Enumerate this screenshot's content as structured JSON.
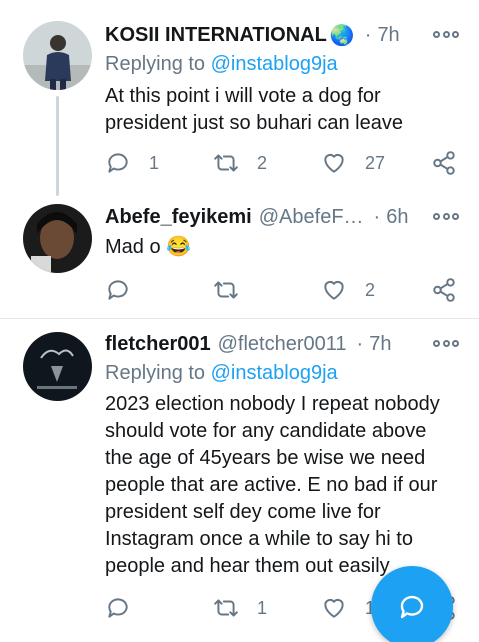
{
  "colors": {
    "accent": "#1da1f2",
    "secondary_text": "#657786",
    "primary_text": "#14171a",
    "divider": "#e1e8ed"
  },
  "tweets": [
    {
      "name": "KOSII INTERNATIONAL",
      "name_emoji": "🌏",
      "handle": "",
      "time": "7h",
      "replying_prefix": "Replying to",
      "replying_to": "@instablog9ja",
      "text_lines": [
        "At this point i will vote a dog for",
        "president just so buhari can leave"
      ],
      "counts": {
        "replies": "1",
        "retweets": "2",
        "likes": "27"
      }
    },
    {
      "name": "Abefe_feyikemi",
      "handle": "@AbefeF…",
      "time": "6h",
      "text": "Mad o",
      "text_emoji": "😂",
      "counts": {
        "replies": "",
        "retweets": "",
        "likes": "2"
      }
    },
    {
      "name": "fletcher001",
      "handle": "@fletcher0011",
      "time": "7h",
      "replying_prefix": "Replying to",
      "replying_to": "@instablog9ja",
      "text_lines": [
        "2023 election nobody I repeat nobody",
        "should vote for any candidate above",
        "the age of 45years be wise we need",
        "people that are active. E no bad if our",
        "president self dey come live for",
        "Instagram once a while to say hi to",
        "people and hear them out easily"
      ],
      "counts": {
        "replies": "",
        "retweets": "1",
        "likes": "1"
      }
    }
  ],
  "separator_dot": "·",
  "icons": [
    "reply-icon",
    "retweet-icon",
    "like-icon",
    "share-icon",
    "more-icon",
    "compose-reply-icon"
  ]
}
